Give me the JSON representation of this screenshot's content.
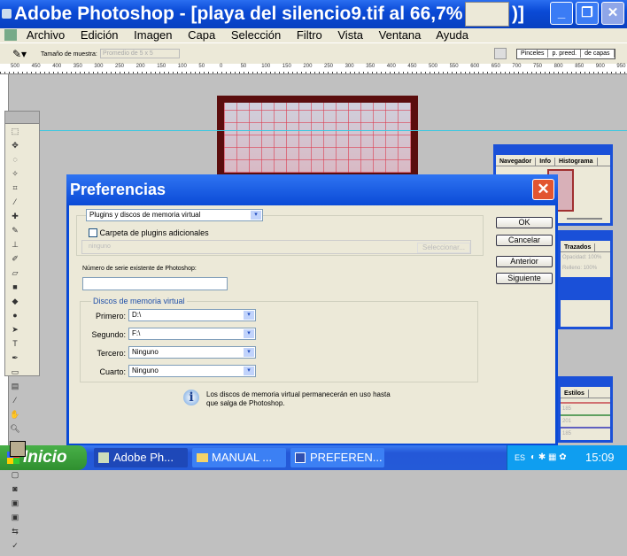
{
  "window": {
    "title": "Adobe Photoshop - [playa del silencio9.tif al 66,7% (L",
    "title_end": ")]",
    "minimize": "_",
    "maximize": "❐",
    "close": "✕"
  },
  "menu": [
    "Archivo",
    "Edición",
    "Imagen",
    "Capa",
    "Selección",
    "Filtro",
    "Vista",
    "Ventana",
    "Ayuda"
  ],
  "options": {
    "sample_label": "Tamaño de muestra:",
    "sample_value": "Promedio de 5 x 5",
    "tabs": [
      "Pinceles",
      "p. preed.",
      "de capas"
    ]
  },
  "ruler": [
    "500",
    "450",
    "400",
    "350",
    "300",
    "250",
    "200",
    "150",
    "100",
    "50",
    "0",
    "50",
    "100",
    "150",
    "200",
    "250",
    "300",
    "350",
    "400",
    "450",
    "500",
    "550",
    "600",
    "650",
    "700",
    "750",
    "800",
    "850",
    "900",
    "950"
  ],
  "panels": {
    "navigator_tabs": [
      "Navegador",
      "Info",
      "Histograma"
    ],
    "layers_tabs": [
      "Trazados"
    ],
    "layers_rows": [
      "Opacidad:",
      "Relleno:"
    ],
    "layers_values": [
      "100%",
      "100%"
    ],
    "styles_tabs": [
      "Estilos"
    ],
    "styles_values": [
      "185",
      "201",
      "185"
    ]
  },
  "dialog": {
    "title": "Preferencias",
    "section": "Plugins y discos de memoria virtual",
    "plugins_checkbox": "Carpeta de plugins adicionales",
    "plugins_checked": false,
    "plugins_path": "ninguno",
    "select_button": "Seleccionar...",
    "serial_label": "Número de serie existente de Photoshop:",
    "serial_value": "",
    "scratch_group": "Discos de memoria virtual",
    "scratch": [
      {
        "label": "Primero:",
        "value": "D:\\"
      },
      {
        "label": "Segundo:",
        "value": "F:\\"
      },
      {
        "label": "Tercero:",
        "value": "Ninguno"
      },
      {
        "label": "Cuarto:",
        "value": "Ninguno"
      }
    ],
    "info": "Los discos de memoria virtual permanecerán en uso hasta que salga de Photoshop.",
    "buttons": {
      "ok": "OK",
      "cancel": "Cancelar",
      "prev": "Anterior",
      "next": "Siguiente"
    }
  },
  "taskbar": {
    "start": "Inicio",
    "tasks": [
      "Adobe Ph...",
      "MANUAL ...",
      "PREFEREN..."
    ],
    "lang": "ES",
    "clock": "15:09"
  }
}
